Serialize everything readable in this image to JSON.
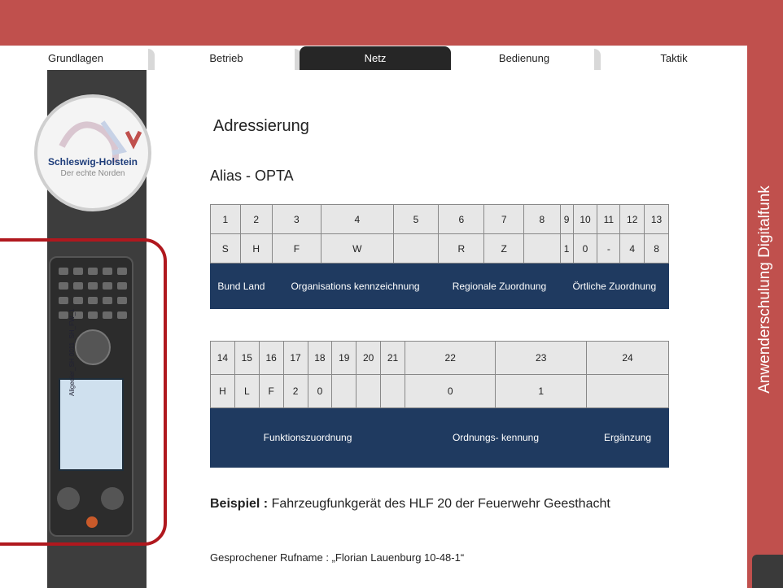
{
  "tabs": [
    {
      "label": "Grundlagen",
      "active": false
    },
    {
      "label": "Betrieb",
      "active": false
    },
    {
      "label": "Netz",
      "active": true
    },
    {
      "label": "Bedienung",
      "active": false
    },
    {
      "label": "Taktik",
      "active": false
    }
  ],
  "side_title": "Anwenderschulung Digitalfunk",
  "logo": {
    "line1": "Schleswig-Holstein",
    "line2": "Der echte Norden"
  },
  "device_screen_text": "Aligeeier_SH 0011_SH_FW_1",
  "heading": "Adressierung",
  "subheading": "Alias - OPTA",
  "table1": {
    "numbers": [
      "1",
      "2",
      "3",
      "4",
      "5",
      "6",
      "7",
      "8",
      "9",
      "10",
      "11",
      "12",
      "13"
    ],
    "values": [
      "S",
      "H",
      "F",
      "W",
      "",
      "R",
      "Z",
      "",
      "1",
      "0",
      "-",
      "4",
      "8"
    ],
    "labels": [
      {
        "text": "Bund Land",
        "span": 2
      },
      {
        "text": "Organisations kennzeichnung",
        "span": 3
      },
      {
        "text": "Regionale Zuordnung",
        "span": 3
      },
      {
        "text": "Örtliche Zuordnung",
        "span": 5
      }
    ]
  },
  "table2": {
    "numbers": [
      "14",
      "15",
      "16",
      "17",
      "18",
      "19",
      "20",
      "21",
      "22",
      "23",
      "24"
    ],
    "values": [
      "H",
      "L",
      "F",
      "2",
      "0",
      "",
      "",
      "",
      "0",
      "1",
      ""
    ],
    "labels": [
      {
        "text": "Funktionszuordnung",
        "span": 8
      },
      {
        "text": "Ordnungs- kennung",
        "span": 2
      },
      {
        "text": "Ergänzung",
        "span": 1
      }
    ]
  },
  "example": {
    "bold": "Beispiel :",
    "text": "Fahrzeugfunkgerät des HLF 20 der Feuerwehr Geesthacht"
  },
  "callname": "Gesprochener Rufname : „Florian Lauenburg 10-48-1“",
  "colors": {
    "accent": "#c0504d",
    "table_header": "#1f3a60",
    "frame": "#b0181e"
  }
}
